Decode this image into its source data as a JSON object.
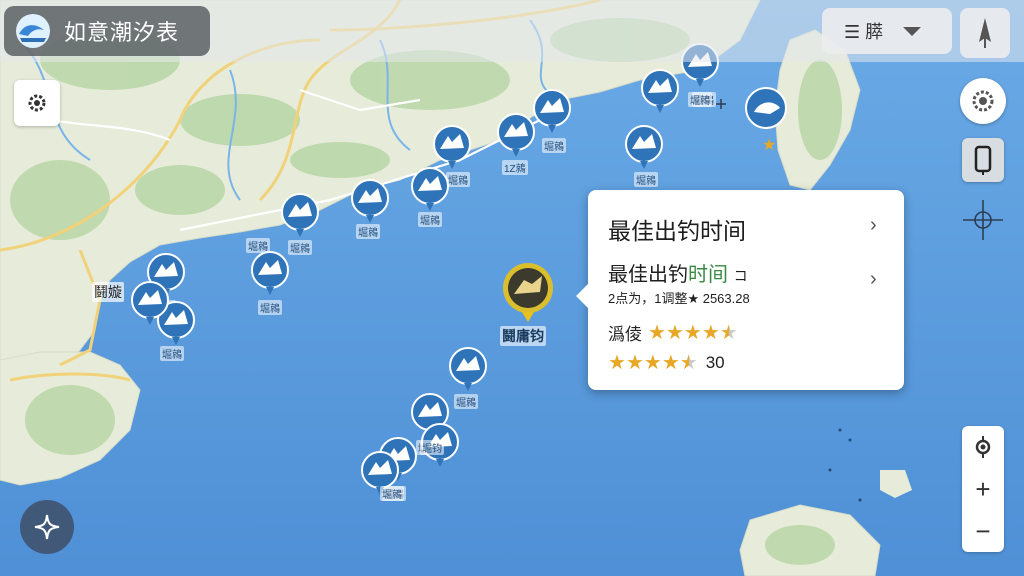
{
  "app": {
    "title": "如意潮汐表"
  },
  "top_right": {
    "layer_button_label": "☰ 膵",
    "icons": [
      "list-icon",
      "chevron-down-icon",
      "compass-icon"
    ]
  },
  "colors": {
    "sea": "#5f9fe0",
    "land": "#e6ecd9",
    "marker": "#2f73b8",
    "marker_selected": "#e8c21a",
    "star": "#e7a827"
  },
  "map": {
    "place_labels": [
      "鬪嫙"
    ],
    "markers": [
      {
        "label": "堀鶁"
      },
      {
        "label": "堀鶁"
      },
      {
        "label": "1Z鶁"
      },
      {
        "label": "堀鶁"
      },
      {
        "label": "堀鶁"
      },
      {
        "label": "堀鶁"
      },
      {
        "label": "堀鶁"
      },
      {
        "label": "堀鶁"
      },
      {
        "label": "堀鶁"
      },
      {
        "label": "堀鶁"
      },
      {
        "label": "珖鶁"
      },
      {
        "label": "堀鶁"
      },
      {
        "label": "堀鶁"
      },
      {
        "label": "堀鶁"
      },
      {
        "label": "堀鶁"
      },
      {
        "label": "堀鶁"
      },
      {
        "label": "堀钧"
      },
      {
        "label": "堀鶁"
      },
      {
        "label": ""
      }
    ],
    "selected_marker": {
      "label": "鬪庸钧"
    }
  },
  "popup": {
    "title": "最佳出钓时间",
    "row2_main": "最佳出钓",
    "row2_highlight": "时间",
    "row2_suffix": "コ",
    "row3": "2点为，1调整★ 2563.28",
    "rating1_label": "潙倰",
    "rating1_value": 4.5,
    "rating2_value": 4.5,
    "rating2_count": "30"
  },
  "controls": {
    "zoom_in": "+",
    "zoom_out": "−"
  }
}
